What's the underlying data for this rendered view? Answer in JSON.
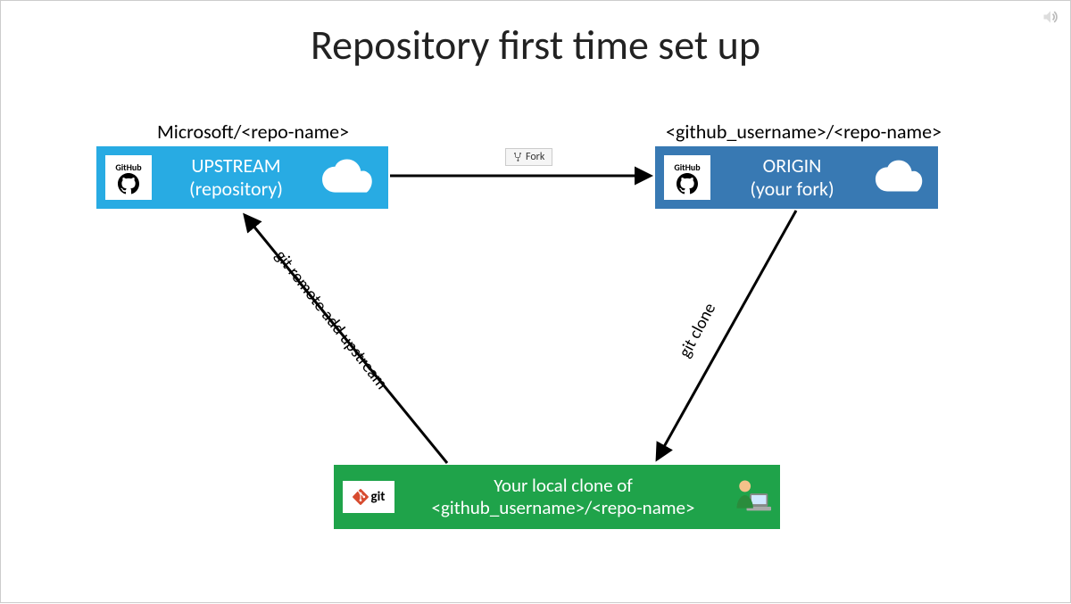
{
  "title": "Repository first time set up",
  "labels": {
    "upstream_above": "Microsoft/<repo-name>",
    "origin_above": "<github_username>/<repo-name>"
  },
  "boxes": {
    "upstream": {
      "line1": "UPSTREAM",
      "line2": "(repository)",
      "logo": "GitHub"
    },
    "origin": {
      "line1": "ORIGIN",
      "line2": "(your fork)",
      "logo": "GitHub"
    },
    "local": {
      "line1": "Your local clone of",
      "line2": "<github_username>/<repo-name>",
      "logo": "git"
    }
  },
  "arrows": {
    "fork_label": "Fork",
    "remote_add": "git remote add upstream",
    "clone": "git clone"
  },
  "colors": {
    "upstream": "#28abe3",
    "origin": "#3879b3",
    "local": "#1fa34a"
  }
}
